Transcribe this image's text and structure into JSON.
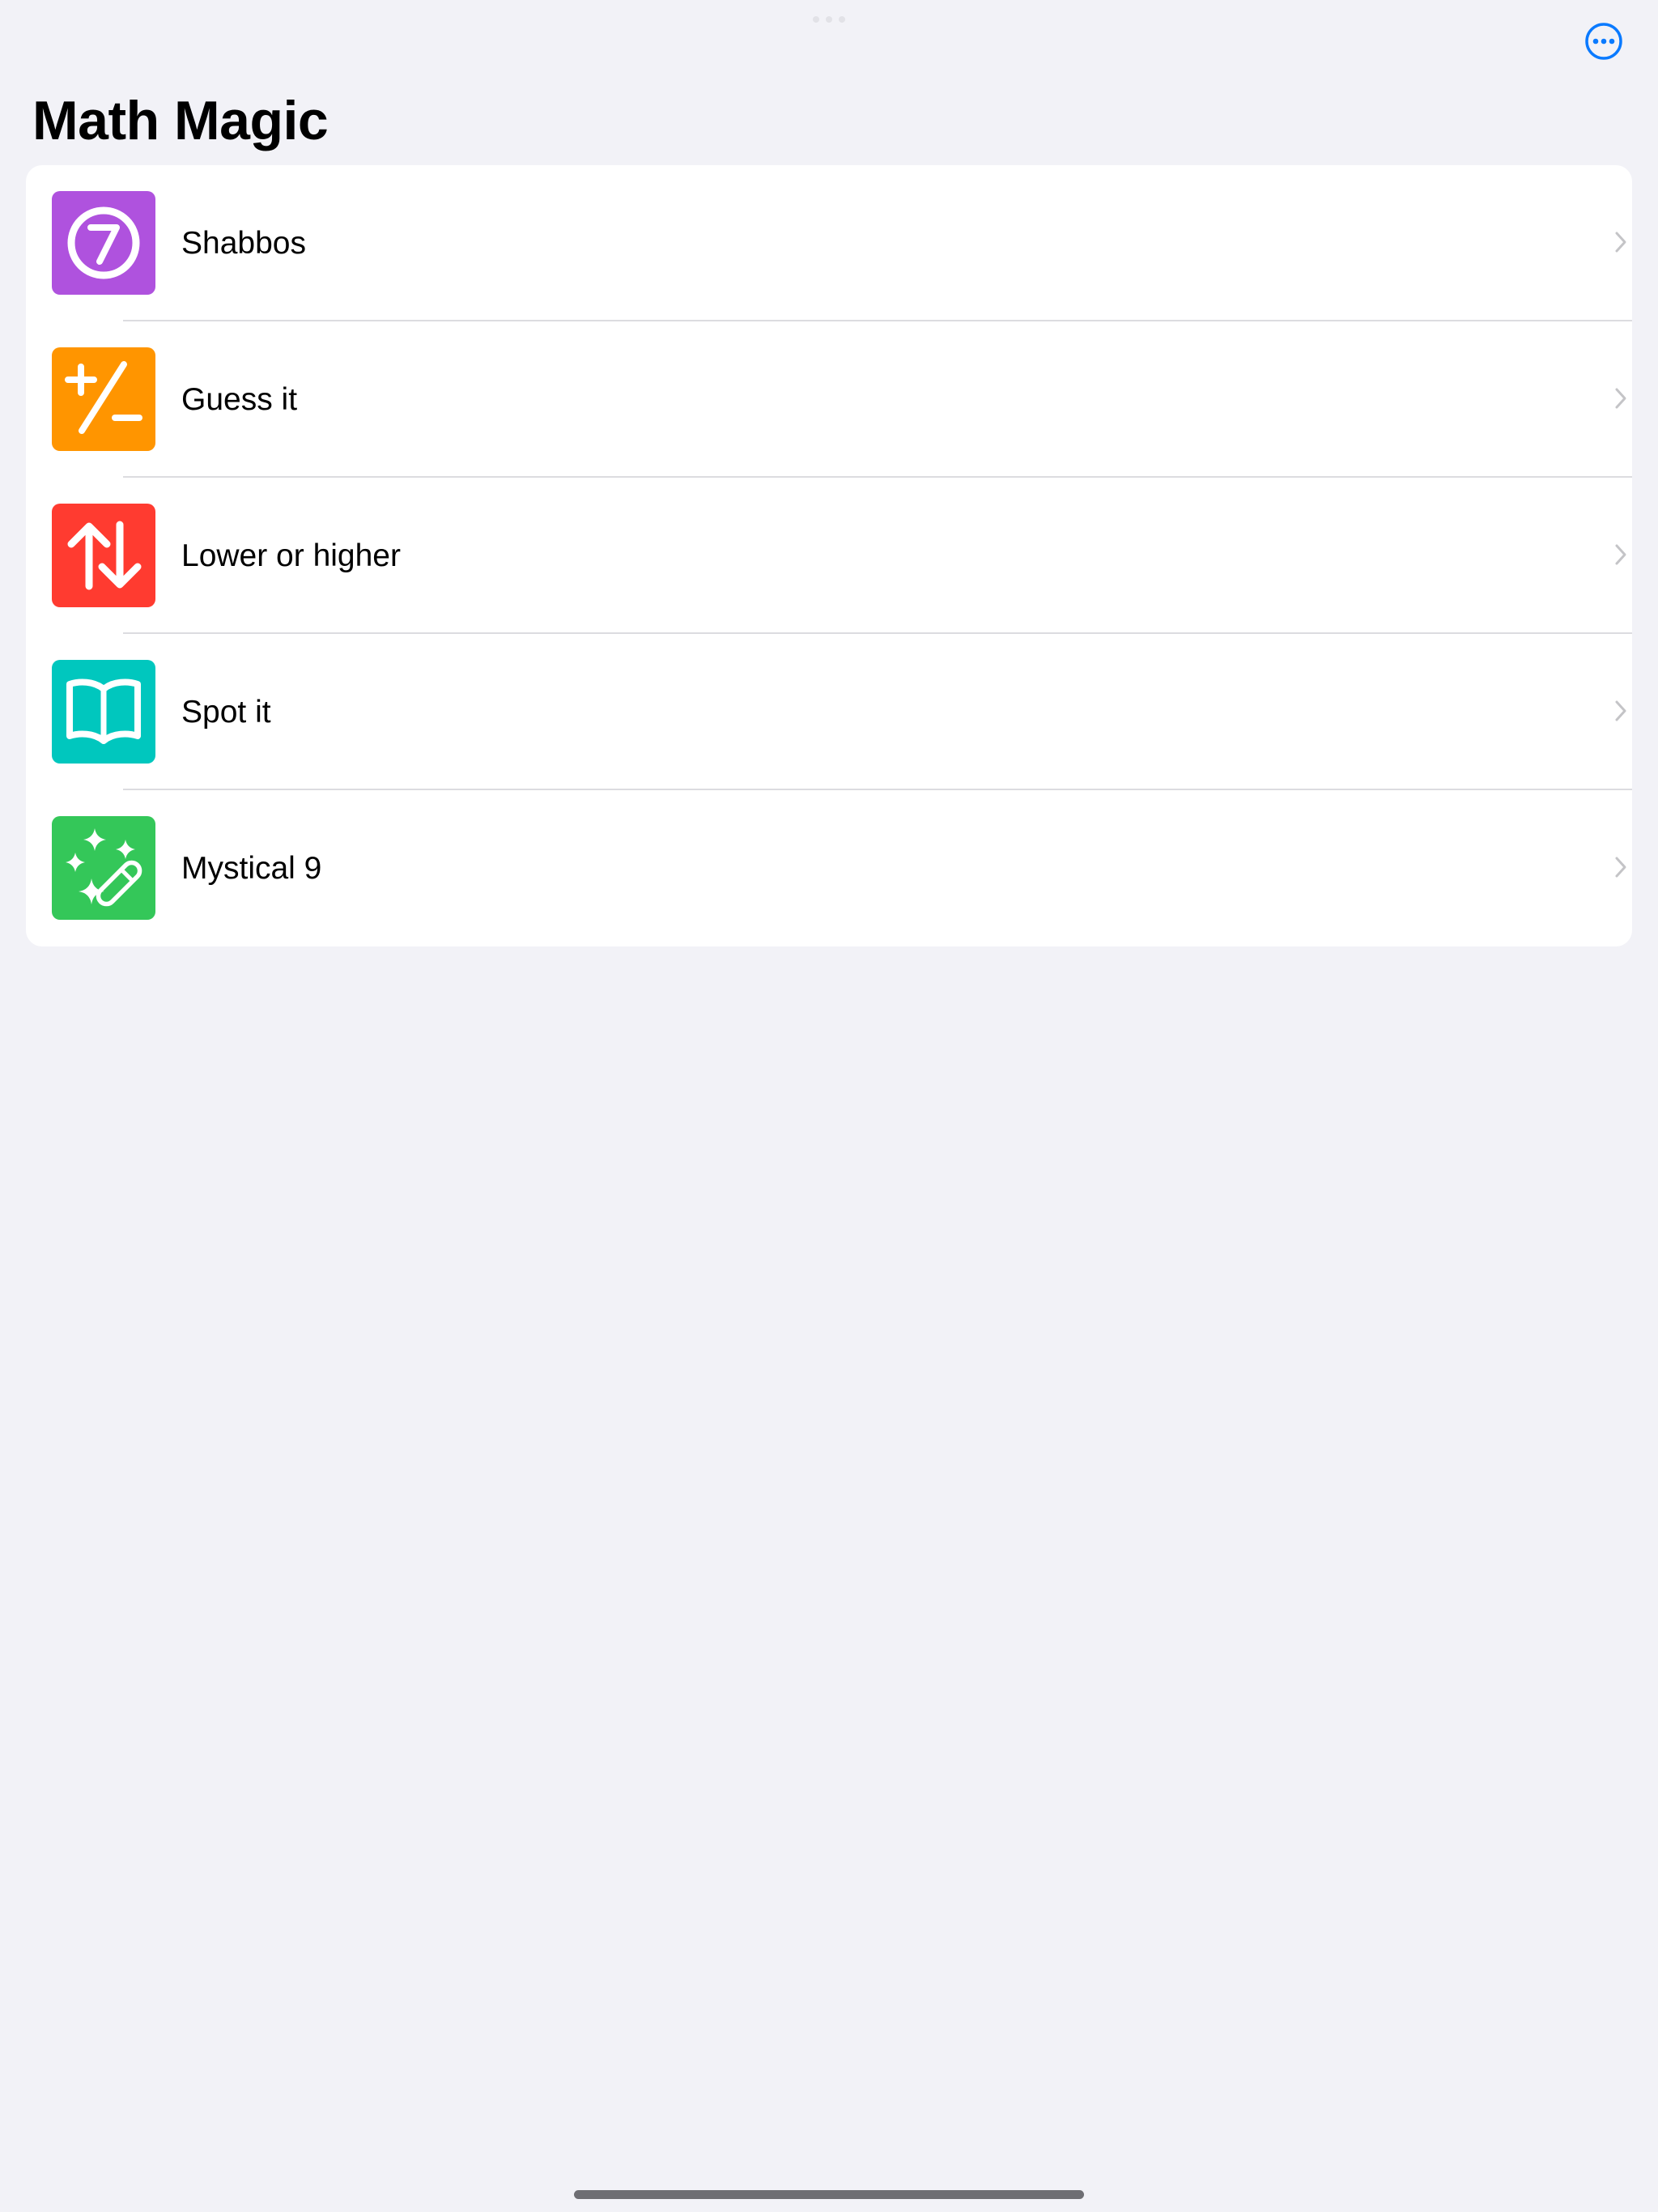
{
  "header": {
    "title": "Math Magic",
    "more_icon": "ellipsis-circle-icon",
    "accent_color": "#0a7aff"
  },
  "list": {
    "items": [
      {
        "label": "Shabbos",
        "icon": "seven-circle-icon",
        "color": "#af52de"
      },
      {
        "label": "Guess it",
        "icon": "plus-slash-minus-icon",
        "color": "#ff9500"
      },
      {
        "label": "Lower or higher",
        "icon": "arrow-up-arrow-down-icon",
        "color": "#ff3b30"
      },
      {
        "label": "Spot it",
        "icon": "book-icon",
        "color": "#00c7be"
      },
      {
        "label": "Mystical 9",
        "icon": "magic-wand-icon",
        "color": "#34c759"
      }
    ],
    "chevron_icon": "chevron-right-icon"
  }
}
